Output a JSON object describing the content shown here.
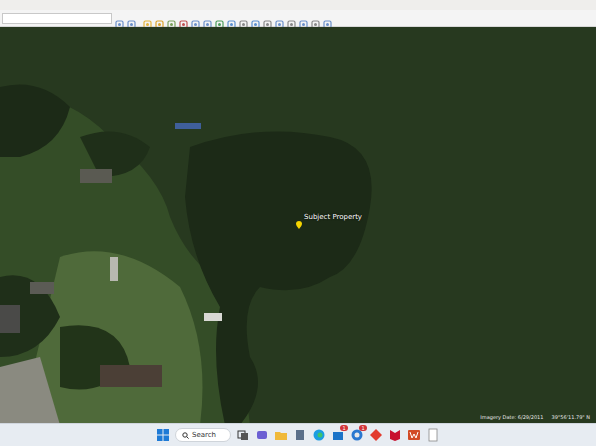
{
  "map": {
    "placemark": {
      "label": "Subject Property"
    },
    "imagery_date": "Imagery Date: 6/29/2011",
    "coordinates": "39°56'11.79\" N"
  },
  "taskbar": {
    "search": {
      "label": "Search"
    },
    "apps": [
      {
        "kind": "start",
        "badge": ""
      },
      {
        "kind": "taskview",
        "badge": ""
      },
      {
        "kind": "chat",
        "badge": ""
      },
      {
        "kind": "files",
        "badge": ""
      },
      {
        "kind": "calc",
        "badge": ""
      },
      {
        "kind": "edge",
        "badge": ""
      },
      {
        "kind": "store",
        "badge": "1"
      },
      {
        "kind": "earth",
        "badge": "1"
      },
      {
        "kind": "diamond",
        "badge": ""
      },
      {
        "kind": "mcafee",
        "badge": ""
      },
      {
        "kind": "word",
        "badge": ""
      },
      {
        "kind": "notepad",
        "badge": ""
      }
    ]
  }
}
